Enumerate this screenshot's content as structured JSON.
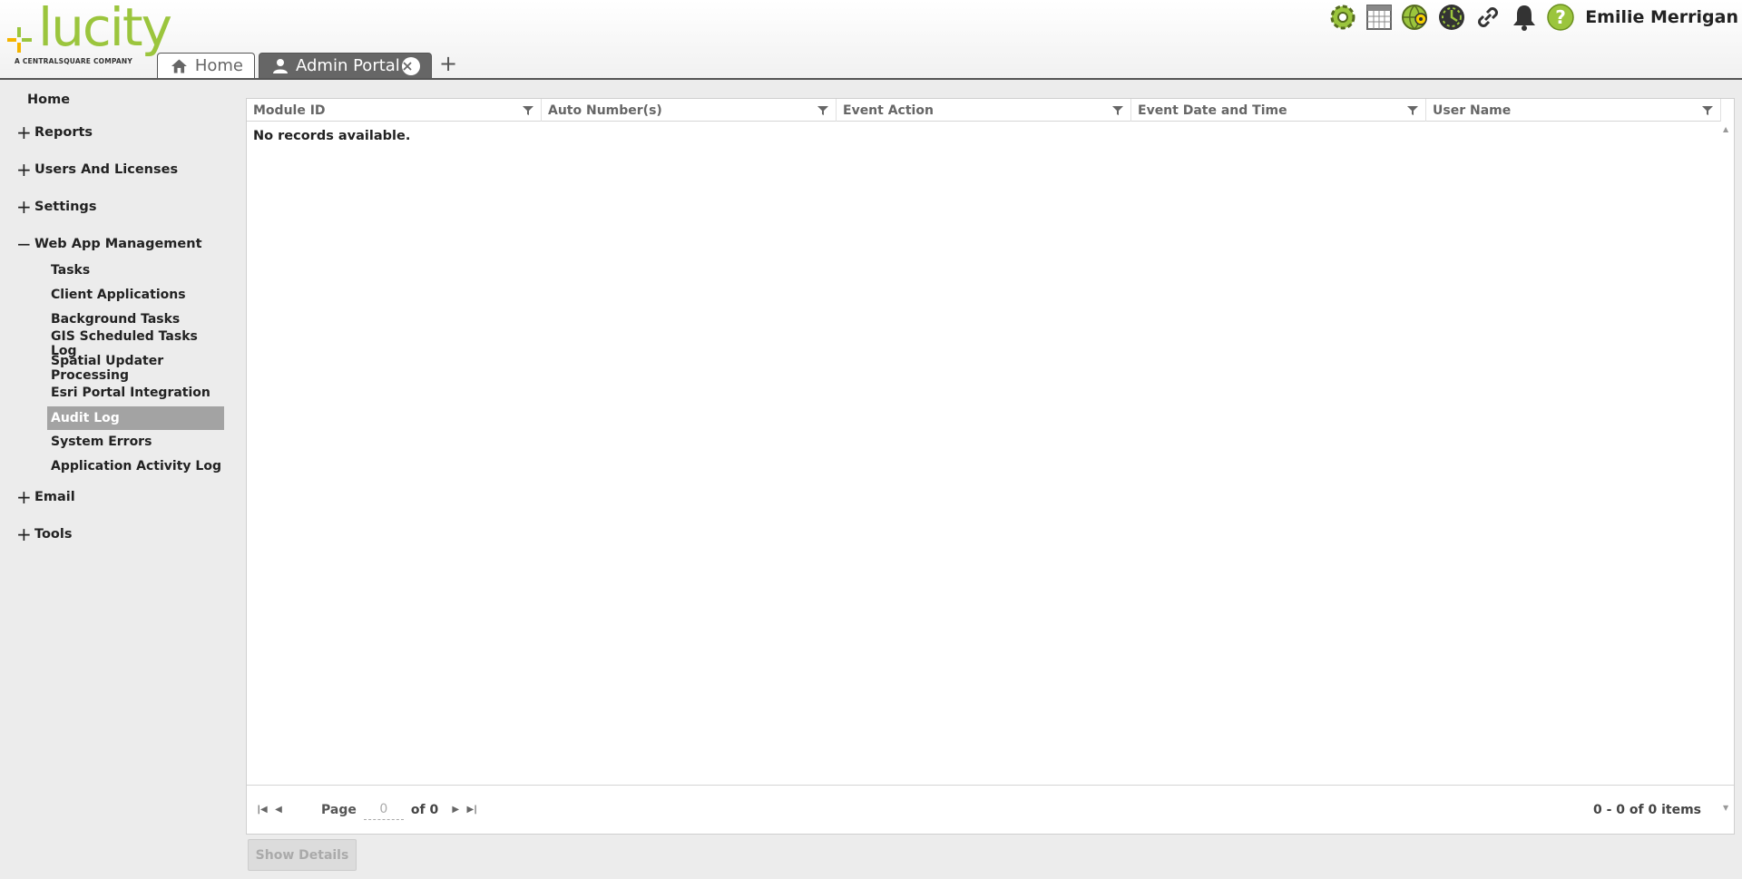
{
  "brand": {
    "name": "lucity",
    "tagline": "A CENTRALSQUARE COMPANY",
    "accent": "#9bc53d"
  },
  "tabs": [
    {
      "label": "Home",
      "icon": "home-icon",
      "active": false
    },
    {
      "label": "Admin Portal",
      "icon": "user-icon",
      "active": true
    }
  ],
  "add_tab": "+",
  "header": {
    "icons": [
      "settings-gear-icon",
      "calendar-grid-icon",
      "globe-map-icon",
      "clock-icon",
      "link-icon",
      "bell-icon",
      "help-icon"
    ],
    "user_name": "Emilie Merrigan"
  },
  "sidebar": {
    "home": "Home",
    "groups": [
      {
        "label": "Reports",
        "expanded": false
      },
      {
        "label": "Users And Licenses",
        "expanded": false
      },
      {
        "label": "Settings",
        "expanded": false
      },
      {
        "label": "Web App Management",
        "expanded": true
      },
      {
        "label": "Email",
        "expanded": false
      },
      {
        "label": "Tools",
        "expanded": false
      }
    ],
    "web_app_items": [
      "Tasks",
      "Client Applications",
      "Background Tasks",
      "GIS Scheduled Tasks Log",
      "Spatial Updater Processing",
      "Esri Portal Integration",
      "Audit Log",
      "System Errors",
      "Application Activity Log"
    ],
    "selected": "Audit Log"
  },
  "grid": {
    "columns": [
      "Module ID",
      "Auto Number(s)",
      "Event Action",
      "Event Date and Time",
      "User Name"
    ],
    "empty_message": "No records available.",
    "pager": {
      "page_label": "Page",
      "page_value": "0",
      "of_label": "of 0",
      "summary": "0 - 0 of 0 items"
    }
  },
  "show_details_label": "Show Details"
}
